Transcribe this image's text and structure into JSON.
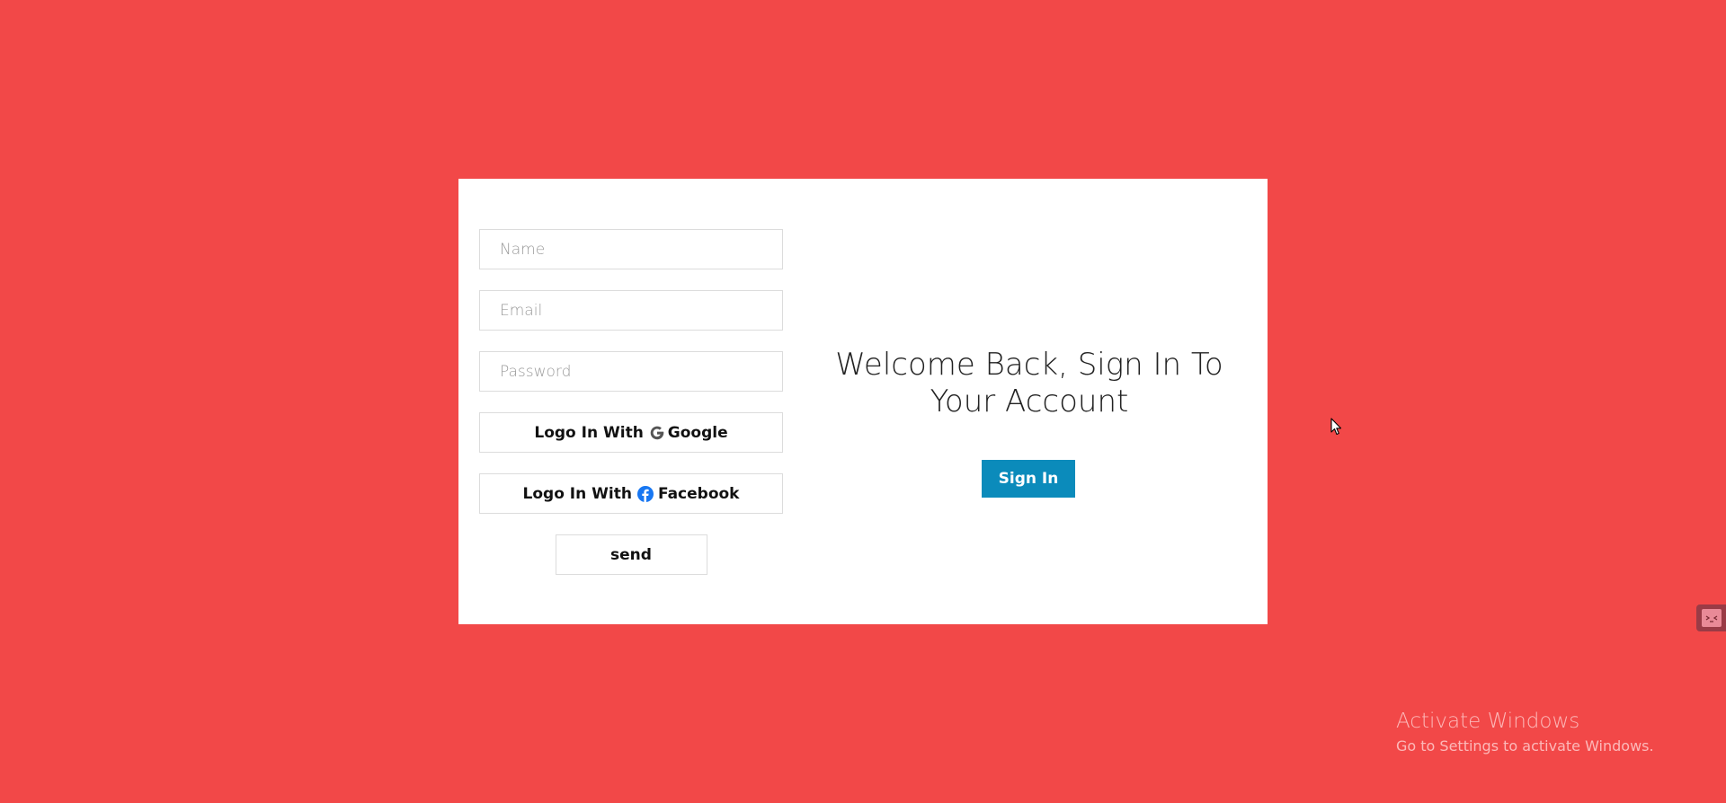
{
  "form": {
    "name_placeholder": "Name",
    "email_placeholder": "Email",
    "password_placeholder": "Password",
    "google_prefix": "Logo In With",
    "google_label": "Google",
    "facebook_prefix": "Logo In With",
    "facebook_label": "Facebook",
    "send_label": "send"
  },
  "welcome": {
    "title": "Welcome Back, Sign In To Your Account",
    "signin_label": "Sign In"
  },
  "watermark": {
    "title": "Activate Windows",
    "subtitle": "Go to Settings to activate Windows."
  },
  "colors": {
    "background": "#f24848",
    "card": "#ffffff",
    "signin_button": "#0b8bbb",
    "facebook_blue": "#1877f2",
    "google_gray": "#555555"
  },
  "icons": {
    "google": "google-g-icon",
    "facebook": "facebook-icon",
    "cursor": "mouse-cursor-icon",
    "side_widget": "extension-icon"
  }
}
